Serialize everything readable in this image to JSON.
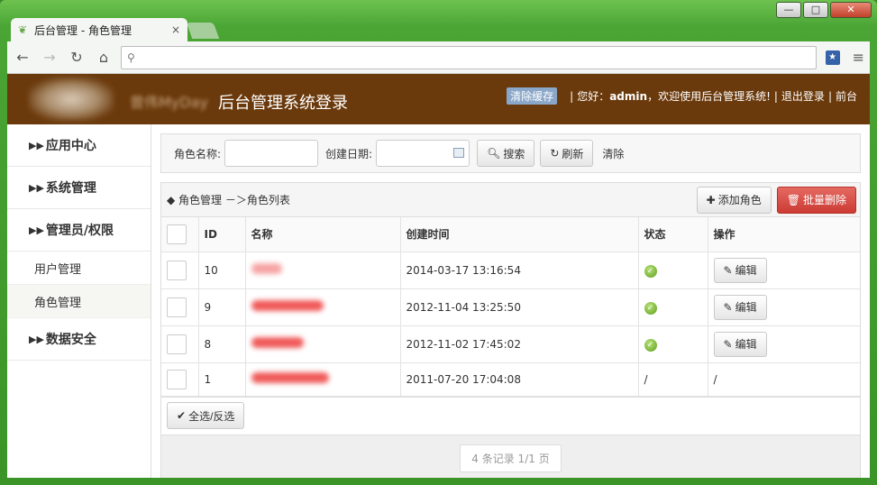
{
  "browser": {
    "tab_title": "后台管理 - 角色管理",
    "tab_close": "×",
    "address": "",
    "controls": {
      "minimize": "—",
      "maximize": "□",
      "close": "✕"
    }
  },
  "header": {
    "logo_text": "曾伟MyDay",
    "title": "后台管理系统登录",
    "clear_cache": "清除缓存",
    "greeting_prefix": "您好：",
    "username": "admin",
    "greeting_suffix": "，欢迎使用后台管理系统!",
    "logout": "退出登录",
    "front": "前台"
  },
  "sidebar": {
    "items": [
      {
        "label": "应用中心",
        "type": "group"
      },
      {
        "label": "系统管理",
        "type": "group"
      },
      {
        "label": "管理员/权限",
        "type": "group"
      },
      {
        "label": "用户管理",
        "type": "sub"
      },
      {
        "label": "角色管理",
        "type": "sub",
        "active": true
      },
      {
        "label": "数据安全",
        "type": "group"
      }
    ]
  },
  "search": {
    "role_name_label": "角色名称:",
    "role_name_value": "",
    "created_date_label": "创建日期:",
    "created_date_value": "",
    "search_button": "搜索",
    "refresh_button": "刷新",
    "clear_link": "清除"
  },
  "panel": {
    "breadcrumb": "◆ 角色管理 －＞角色列表",
    "add_button": "添加角色",
    "batch_delete_button": "批量删除",
    "columns": [
      "ID",
      "名称",
      "创建时间",
      "状态",
      "操作"
    ],
    "rows": [
      {
        "id": "10",
        "created": "2014-03-17 13:16:54",
        "status": "ok",
        "action": "编辑"
      },
      {
        "id": "9",
        "created": "2012-11-04 13:25:50",
        "status": "ok",
        "action": "编辑"
      },
      {
        "id": "8",
        "created": "2012-11-02 17:45:02",
        "status": "ok",
        "action": "编辑"
      },
      {
        "id": "1",
        "created": "2011-07-20 17:04:08",
        "status": "/",
        "action": "/"
      }
    ],
    "select_all_button": "全选/反选",
    "pager_text": "4 条记录 1/1 页"
  },
  "colors": {
    "header_bg": "#6b3a0c",
    "danger": "#cc3b33",
    "success": "#5e9e1c"
  }
}
